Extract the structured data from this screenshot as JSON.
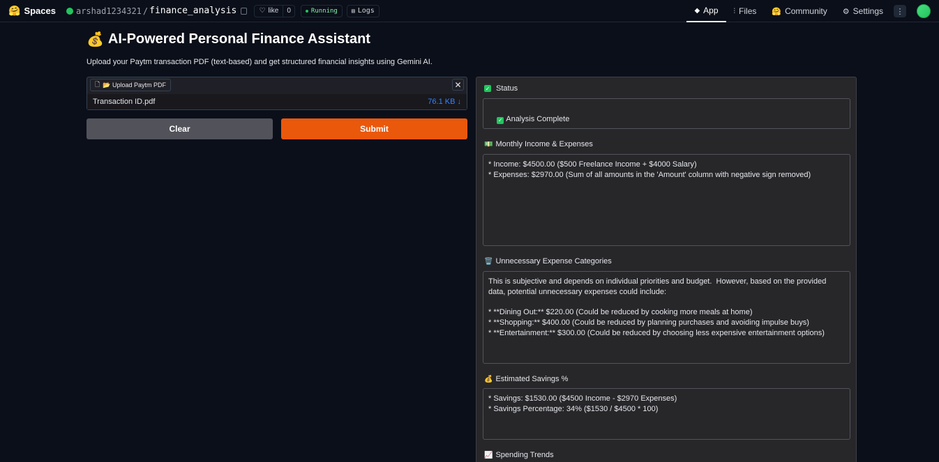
{
  "topbar": {
    "brand": "Spaces",
    "user": "arshad1234321",
    "repo": "finance_analysis",
    "like_label": "like",
    "like_count": "0",
    "status": "Running",
    "logs_label": "Logs",
    "nav": [
      {
        "label": "App",
        "active": true
      },
      {
        "label": "Files"
      },
      {
        "label": "Community"
      },
      {
        "label": "Settings"
      }
    ],
    "more": "⋮"
  },
  "main": {
    "title_emoji": "💰",
    "title": "AI-Powered Personal Finance Assistant",
    "subtitle": "Upload your Paytm transaction PDF (text-based) and get structured financial insights using Gemini AI.",
    "upload": {
      "label": "📂 Upload Paytm PDF",
      "close": "✕",
      "file_name": "Transaction ID.pdf",
      "file_size": "76.1 KB ↓"
    },
    "clear_label": "Clear",
    "submit_label": "Submit"
  },
  "results": {
    "status": {
      "label": "Status",
      "value": "Analysis Complete"
    },
    "income": {
      "icon": "💵",
      "label": "Monthly Income & Expenses",
      "value": "* Income: $4500.00 ($500 Freelance Income + $4000 Salary)\n* Expenses: $2970.00 (Sum of all amounts in the 'Amount' column with negative sign removed)"
    },
    "unnecessary": {
      "icon": "🗑️",
      "label": "Unnecessary Expense Categories",
      "value": "This is subjective and depends on individual priorities and budget.  However, based on the provided data, potential unnecessary expenses could include:\n\n* **Dining Out:** $220.00 (Could be reduced by cooking more meals at home)\n* **Shopping:** $400.00 (Could be reduced by planning purchases and avoiding impulse buys)\n* **Entertainment:** $300.00 (Could be reduced by choosing less expensive entertainment options)"
    },
    "savings": {
      "icon": "💰",
      "label": "Estimated Savings %",
      "value": "* Savings: $1530.00 ($4500 Income - $2970 Expenses)\n* Savings Percentage: 34% ($1530 / $4500 * 100)"
    },
    "trends": {
      "icon": "📈",
      "label": "Spending Trends"
    }
  }
}
